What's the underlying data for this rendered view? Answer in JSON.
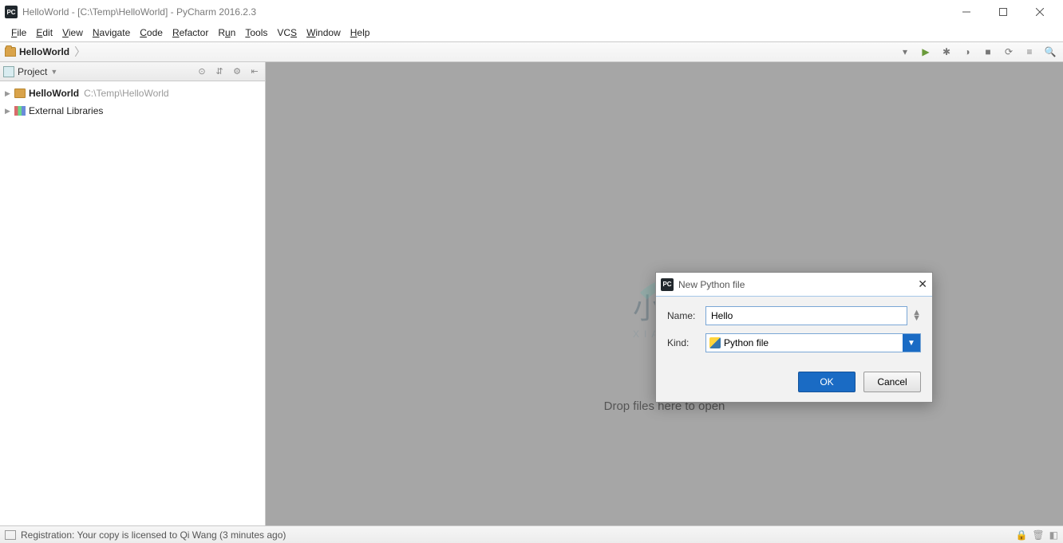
{
  "window": {
    "title": "HelloWorld - [C:\\Temp\\HelloWorld] - PyCharm 2016.2.3"
  },
  "menu": [
    "File",
    "Edit",
    "View",
    "Navigate",
    "Code",
    "Refactor",
    "Run",
    "Tools",
    "VCS",
    "Window",
    "Help"
  ],
  "breadcrumb": {
    "root": "HelloWorld"
  },
  "project_tool": {
    "title": "Project",
    "items": [
      {
        "name": "HelloWorld",
        "path": "C:\\Temp\\HelloWorld",
        "icon": "folder",
        "bold": true
      },
      {
        "name": "External Libraries",
        "path": "",
        "icon": "lib",
        "bold": false
      }
    ]
  },
  "editor": {
    "drop_hint": "Drop files here to open"
  },
  "dialog": {
    "title": "New Python file",
    "name_label": "Name:",
    "name_value": "Hello",
    "kind_label": "Kind:",
    "kind_value": "Python file",
    "ok": "OK",
    "cancel": "Cancel"
  },
  "statusbar": {
    "text": "Registration: Your copy is licensed to Qi Wang (3 minutes ago)"
  },
  "watermark": {
    "cn": "小牛知识库",
    "en": "XIAO NIU ZHI SHI KU"
  }
}
